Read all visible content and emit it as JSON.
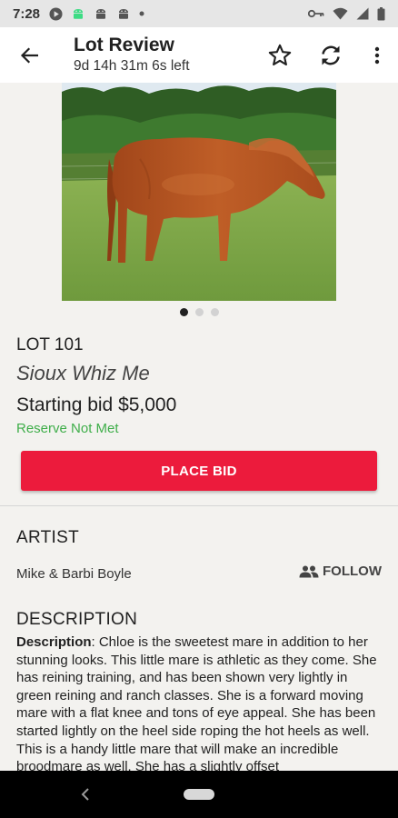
{
  "status_bar": {
    "time": "7:28"
  },
  "app_bar": {
    "title": "Lot Review",
    "countdown": "9d 14h 31m 6s left",
    "icons": [
      "back-arrow-icon",
      "star-outline-icon",
      "refresh-icon",
      "more-vert-icon"
    ]
  },
  "gallery": {
    "image": "chestnut-horse-photo",
    "dot_count": 3,
    "active_index": 0
  },
  "lot": {
    "number": "LOT 101",
    "name": "Sioux Whiz Me",
    "starting_bid": "Starting bid $5,000",
    "reserve_status": "Reserve Not Met"
  },
  "bid_button": {
    "label": "PLACE BID"
  },
  "artist": {
    "heading": "ARTIST",
    "name": "Mike & Barbi Boyle",
    "follow_label": "FOLLOW"
  },
  "description": {
    "heading": "DESCRIPTION",
    "label": "Description",
    "text": ": Chloe is the sweetest mare in addition to her stunning looks. This little mare is athletic as they come. She has reining training, and has been shown very lightly in green reining and ranch classes. She is a forward moving mare with a flat knee and tons of eye appeal. She has been started lightly on the heel side roping the hot heels as well. This is a handy little mare that will make an incredible broodmare as well. She has a slightly offset"
  },
  "colors": {
    "accent_red": "#ec1b3c",
    "reserve_green": "#3fae4a"
  }
}
